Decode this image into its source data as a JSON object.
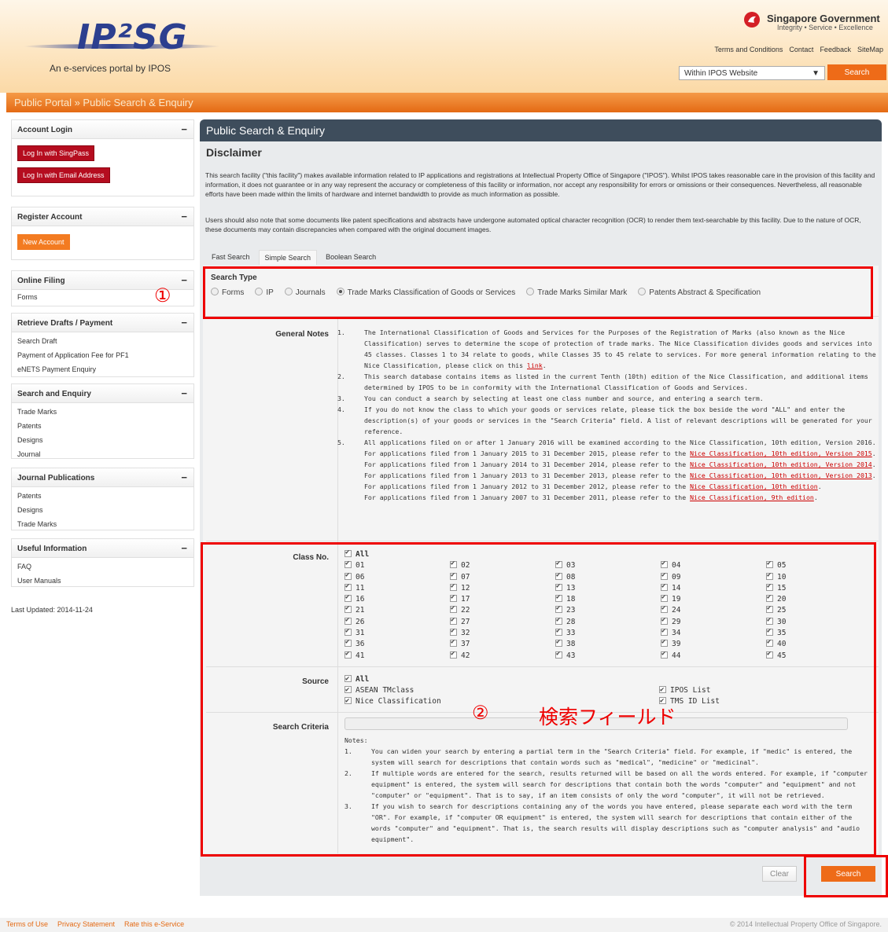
{
  "header": {
    "logo_text": "IP²SG",
    "logo_subtitle": "An e-services portal by IPOS",
    "gov_name": "Singapore Government",
    "gov_motto": "Integrity • Service • Excellence",
    "top_links": [
      "Terms and Conditions",
      "Contact",
      "Feedback",
      "SiteMap"
    ],
    "site_select": "Within IPOS Website",
    "search_label": "Search"
  },
  "breadcrumb": "Public Portal » Public Search & Enquiry",
  "sidebar": {
    "account_login": {
      "title": "Account Login",
      "singpass": "Log In with SingPass",
      "email": "Log In with Email Address"
    },
    "register": {
      "title": "Register Account",
      "new_account": "New Account"
    },
    "online_filing": {
      "title": "Online Filing",
      "items": [
        "Forms"
      ]
    },
    "retrieve": {
      "title": "Retrieve Drafts / Payment",
      "items": [
        "Search Draft",
        "Payment of Application Fee for PF1",
        "eNETS Payment Enquiry"
      ]
    },
    "search_enquiry": {
      "title": "Search and Enquiry",
      "items": [
        "Trade Marks",
        "Patents",
        "Designs",
        "Journal"
      ]
    },
    "journal_pub": {
      "title": "Journal Publications",
      "items": [
        "Patents",
        "Designs",
        "Trade Marks"
      ]
    },
    "useful": {
      "title": "Useful Information",
      "items": [
        "FAQ",
        "User Manuals"
      ]
    },
    "minimize": "−",
    "last_updated": "Last Updated: 2014-11-24"
  },
  "main": {
    "title": "Public Search & Enquiry",
    "disclaimer_title": "Disclaimer",
    "disclaimer_p1": "This search facility (\"this facility\") makes available information related to IP applications and registrations at Intellectual Property Office of Singapore (\"IPOS\"). Whilst IPOS takes reasonable care in the provision of this facility and information, it does not guarantee or in any way represent the accuracy or completeness of this facility or information, nor accept any responsibility for errors or omissions or their consequences. Nevertheless, all reasonable efforts have been made within the limits of hardware and internet bandwidth to provide as much information as possible.",
    "disclaimer_p2": "Users should also note that some documents like patent specifications and abstracts have undergone automated optical character recognition (OCR) to render them text-searchable by this facility. Due to the nature of OCR, these documents may contain discrepancies when compared with the original document images.",
    "tabs": [
      "Fast Search",
      "Simple Search",
      "Boolean Search"
    ],
    "search_type_label": "Search Type",
    "search_types": [
      "Forms",
      "IP",
      "Journals",
      "Trade Marks Classification of Goods or Services",
      "Trade Marks Similar Mark",
      "Patents Abstract & Specification"
    ],
    "general_notes_label": "General Notes",
    "general_notes": [
      {
        "n": "1.",
        "text": "The International Classification of Goods and Services for the Purposes of the Registration of Marks (also known as the Nice Classification) serves to determine the scope of protection of trade marks. The Nice Classification divides goods and services into 45 classes. Classes 1 to 34 relate to goods, while Classes 35 to 45 relate to services. For more general information relating to the Nice Classification, please click on this ",
        "link": "link",
        "after": "."
      },
      {
        "n": "2.",
        "text": "This search database contains items as listed in the current Tenth (10th) edition of the Nice Classification, and additional items determined by IPOS to be in conformity with the International Classification of Goods and Services."
      },
      {
        "n": "3.",
        "text": "You can conduct a search by selecting at least one class number and source, and entering a search term."
      },
      {
        "n": "4.",
        "text": "If you do not know the class to which your goods or services relate, please tick the box beside the word \"ALL\" and enter the description(s) of your goods or services in the \"Search Criteria\" field. A list of relevant descriptions will be generated for your reference."
      },
      {
        "n": "5.",
        "text": "All applications filed on or after 1 January 2016 will be examined according to the Nice Classification, 10th edition, Version 2016."
      }
    ],
    "version_lines": [
      {
        "text": "For applications filed from 1 January 2015 to 31 December 2015, please refer to the ",
        "link": "Nice Classification, 10th edition, Version 2015"
      },
      {
        "text": "For applications filed from 1 January 2014 to 31 December 2014, please refer to the ",
        "link": "Nice Classification, 10th edition, Version 2014"
      },
      {
        "text": "For applications filed from 1 January 2013 to 31 December 2013, please refer to the ",
        "link": "Nice Classification, 10th edition, Version 2013"
      },
      {
        "text": "For applications filed from 1 January 2012 to 31 December 2012, please refer to the ",
        "link": "Nice Classification, 10th edition"
      },
      {
        "text": "For applications filed from 1 January 2007 to 31 December 2011, please refer to the ",
        "link": "Nice Classification, 9th edition"
      }
    ],
    "class_no_label": "Class No.",
    "class_all": "All",
    "classes": [
      "01",
      "02",
      "03",
      "04",
      "05",
      "06",
      "07",
      "08",
      "09",
      "10",
      "11",
      "12",
      "13",
      "14",
      "15",
      "16",
      "17",
      "18",
      "19",
      "20",
      "21",
      "22",
      "23",
      "24",
      "25",
      "26",
      "27",
      "28",
      "29",
      "30",
      "31",
      "32",
      "33",
      "34",
      "35",
      "36",
      "37",
      "38",
      "39",
      "40",
      "41",
      "42",
      "43",
      "44",
      "45"
    ],
    "source_label": "Source",
    "source_all": "All",
    "sources": [
      "ASEAN TMclass",
      "IPOS List",
      "Nice Classification",
      "TMS ID List"
    ],
    "criteria_label": "Search Criteria",
    "notes_title": "Notes:",
    "notes": [
      {
        "n": "1.",
        "text": "You can widen your search by entering a partial term in the \"Search Criteria\" field. For example, if \"medic\" is entered, the system will search for descriptions that contain words such as \"medical\", \"medicine\" or \"medicinal\"."
      },
      {
        "n": "2.",
        "text": "If multiple words are entered for the search, results returned will be based on all the words entered. For example, if \"computer equipment\" is entered, the system will search for descriptions that contain both the words \"computer\" and \"equipment\" and not \"computer\" or \"equipment\". That is to say, if an item consists of only the word \"computer\", it will not be retrieved."
      },
      {
        "n": "3.",
        "text": "If you wish to search for descriptions containing any of the words you have entered, please separate each word with the term \"OR\". For example, if \"computer OR equipment\" is entered, the system will search for descriptions that contain either of the words \"computer\" and \"equipment\". That is, the search results will display descriptions such as \"computer analysis\" and \"audio equipment\"."
      }
    ],
    "clear": "Clear",
    "search": "Search"
  },
  "annotations": {
    "one": "①",
    "two": "②",
    "field": "検索フィールド"
  },
  "footer": {
    "links": [
      "Terms of Use",
      "Privacy Statement",
      "Rate this e-Service"
    ],
    "copyright": "© 2014 Intellectual Property Office of Singapore."
  },
  "colors": {
    "accent": "#ee6b18",
    "header_dark": "#3e4d5c",
    "login_red": "#b50d1f",
    "annotation": "#e00000"
  }
}
